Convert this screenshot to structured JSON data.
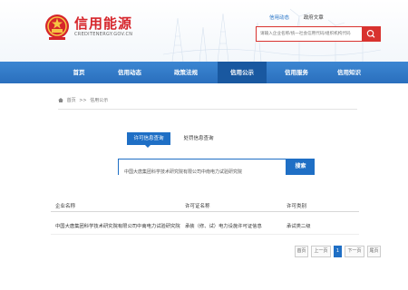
{
  "header": {
    "brand": "信用能源",
    "brand_sub": "CREDITENERGY.GOV.CN",
    "top_links": [
      "信用动态",
      "政府文章"
    ],
    "search_placeholder": "请输入企业名称/统一社会信用代码/组织机构代码"
  },
  "nav": {
    "items": [
      "首页",
      "信用动态",
      "政策法规",
      "信用公示",
      "信用服务",
      "信用知识"
    ],
    "active_index": 3
  },
  "breadcrumb": {
    "home": "首页",
    "separator": ">>",
    "current": "信用公示"
  },
  "tabs": [
    "许可信息查询",
    "处罚信息查询"
  ],
  "search": {
    "value": "中国大唐集团科学技术研究院有限公司中南电力试验研究院",
    "button": "搜索"
  },
  "table": {
    "headers": [
      "企业名称",
      "许可证名称",
      "许可类别"
    ],
    "rows": [
      [
        "中国大唐集团科学技术研究院有限公司中南电力试验研究院",
        "承装（修、试）电力设施许可证信息",
        "承试类二级"
      ]
    ]
  },
  "pagination": {
    "buttons": [
      "首页",
      "上一页",
      "1",
      "下一页",
      "尾页"
    ],
    "current": "1"
  },
  "colors": {
    "brand_red": "#d6252b",
    "primary_blue": "#1f6fc5",
    "nav_blue": "#2a6fbd",
    "search_red": "#d8322f"
  },
  "icons": {
    "logo": "national-emblem-icon",
    "search": "search-icon",
    "home": "home-icon"
  }
}
